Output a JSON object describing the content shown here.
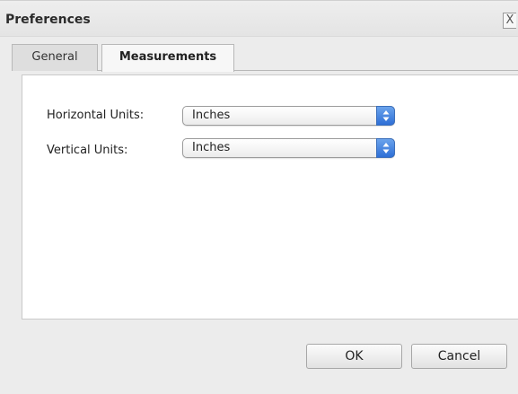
{
  "window": {
    "title": "Preferences",
    "close_label": "X"
  },
  "tabs": [
    {
      "label": "General",
      "selected": false
    },
    {
      "label": "Measurements",
      "selected": true
    }
  ],
  "measurements": {
    "horizontal": {
      "label": "Horizontal Units:",
      "value": "Inches"
    },
    "vertical": {
      "label": "Vertical Units:",
      "value": "Inches"
    }
  },
  "buttons": {
    "ok_label": "OK",
    "cancel_label": "Cancel"
  },
  "icons": {
    "close": "close-icon",
    "select_arrows": "up-down-arrows-icon"
  },
  "colors": {
    "accent": "#2e6fd6",
    "panel_bg": "#ffffff",
    "dialog_bg": "#ececec"
  }
}
